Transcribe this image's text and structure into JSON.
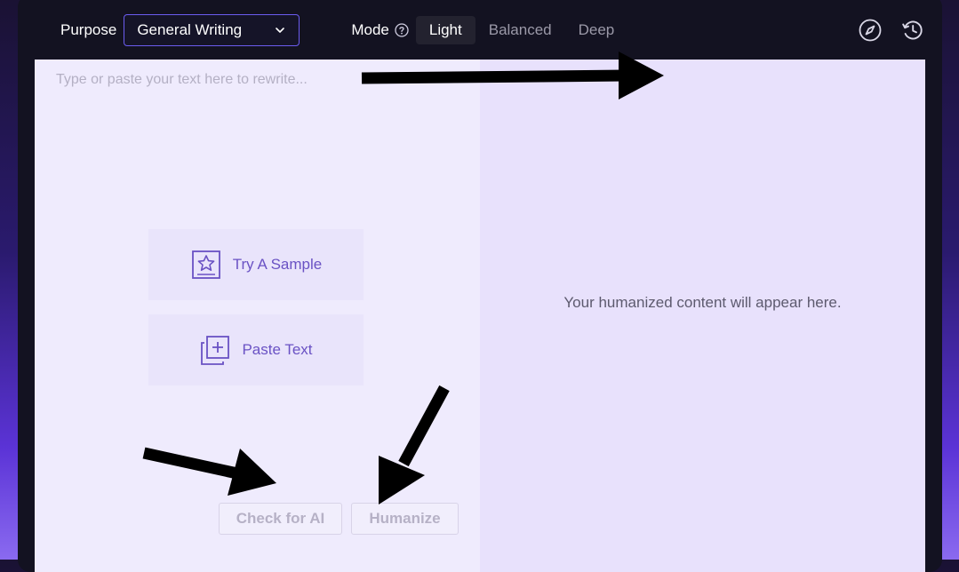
{
  "toolbar": {
    "purpose_label": "Purpose",
    "purpose_value": "General Writing",
    "mode_label": "Mode",
    "modes": [
      "Light",
      "Balanced",
      "Deep"
    ],
    "active_mode": "Light"
  },
  "input_panel": {
    "placeholder": "Type or paste your text here to rewrite...",
    "try_sample_label": "Try A Sample",
    "paste_text_label": "Paste Text",
    "check_ai_label": "Check for AI",
    "humanize_label": "Humanize"
  },
  "output_panel": {
    "message": "Your humanized content will appear here."
  },
  "colors": {
    "accent": "#6b5cf0",
    "card_text": "#6a52c4",
    "annotation_arrow": "#000000"
  }
}
